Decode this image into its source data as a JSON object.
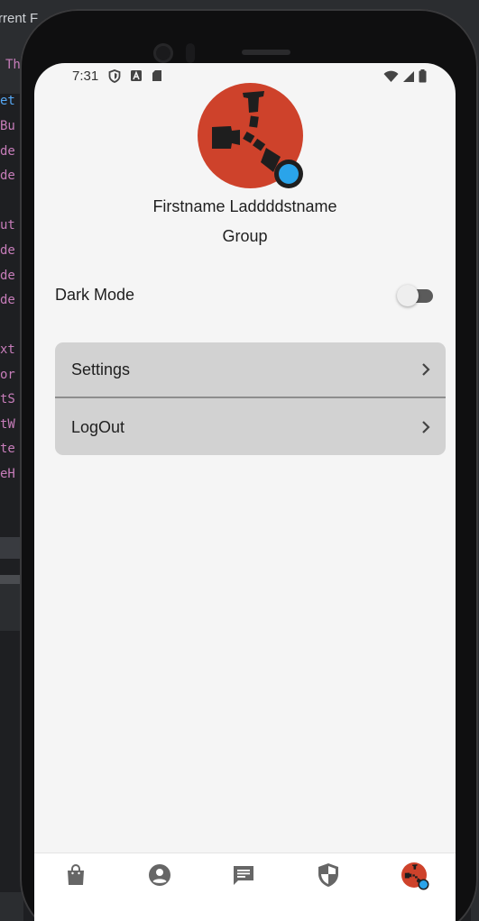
{
  "ide": {
    "title": "rrent F",
    "tab_text": "Th",
    "code_fragments": [
      "et",
      "Bu",
      "de",
      "de",
      "ut",
      "de",
      "de",
      "de",
      "xt",
      "or",
      "tS",
      "tW",
      "te",
      "eH"
    ]
  },
  "status_bar": {
    "time": "7:31",
    "left_icons": [
      "shield-outline-icon",
      "a-box-icon",
      "sd-card-icon"
    ],
    "right_icons": [
      "wifi-icon",
      "cell-signal-icon",
      "battery-icon"
    ]
  },
  "profile": {
    "name": "Firstname Laddddstname",
    "group": "Group",
    "avatar_color": "#ce422b",
    "badge_color": "#2aa4ea"
  },
  "settings": {
    "dark_mode_label": "Dark Mode",
    "dark_mode_on": false
  },
  "menu": {
    "items": [
      {
        "label": "Settings",
        "icon": "chevron-right-icon"
      },
      {
        "label": "LogOut",
        "icon": "chevron-right-icon"
      }
    ]
  },
  "bottom_nav": {
    "items": [
      {
        "icon": "shopping-bag-icon"
      },
      {
        "icon": "account-circle-icon"
      },
      {
        "icon": "message-icon"
      },
      {
        "icon": "shield-icon"
      },
      {
        "icon": "profile-avatar-icon"
      }
    ]
  }
}
